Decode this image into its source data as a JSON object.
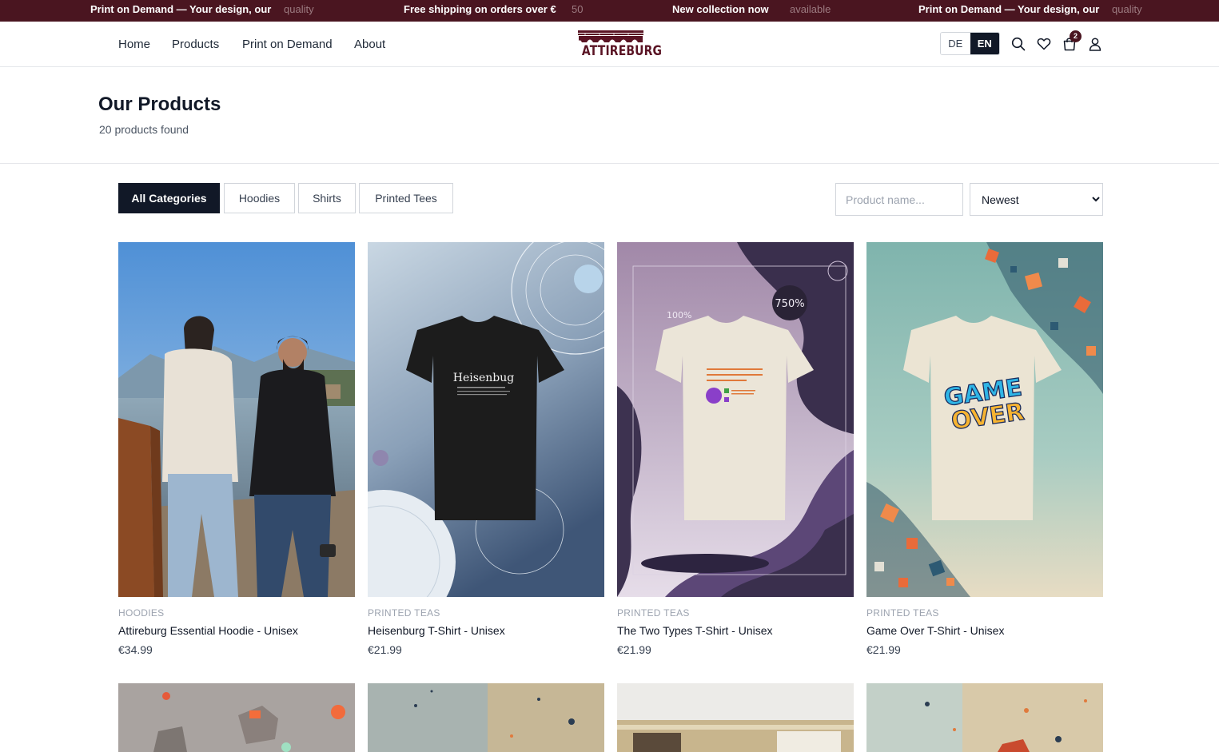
{
  "announcement": {
    "items": [
      {
        "strong": "Print on Demand — Your design, our",
        "dim": "quality"
      },
      {
        "strong": "Free shipping on orders over €",
        "dim": "50"
      },
      {
        "strong": "New collection now",
        "dim": "available"
      },
      {
        "strong": "Print on Demand — Your design, our",
        "dim": "quality"
      }
    ]
  },
  "nav": {
    "items": [
      {
        "label": "Home"
      },
      {
        "label": "Products"
      },
      {
        "label": "Print on Demand"
      },
      {
        "label": "About"
      }
    ]
  },
  "brand": {
    "name": "ATTIREBURG",
    "color": "#5a1424"
  },
  "language": {
    "options": [
      "DE",
      "EN"
    ],
    "active": "EN"
  },
  "header_icons": [
    "search-icon",
    "heart-icon",
    "shopping-bag-icon",
    "user-icon"
  ],
  "cart": {
    "count": "2"
  },
  "page": {
    "title": "Our Products",
    "count_text": "20 products found"
  },
  "filters": {
    "categories": [
      {
        "label": "All Categories",
        "active": true
      },
      {
        "label": "Hoodies",
        "active": false
      },
      {
        "label": "Shirts",
        "active": false
      },
      {
        "label": "Printed Tees",
        "active": false
      }
    ],
    "search_placeholder": "Product name...",
    "sort_options": [
      "Newest"
    ],
    "sort_selected": "Newest"
  },
  "products": [
    {
      "category": "HOODIES",
      "name": "Attireburg Essential Hoodie - Unisex",
      "price": "€34.99"
    },
    {
      "category": "PRINTED TEAS",
      "name": "Heisenburg T-Shirt - Unisex",
      "price": "€21.99",
      "print_text": "Heisenbug"
    },
    {
      "category": "PRINTED TEAS",
      "name": "The Two Types T-Shirt - Unisex",
      "price": "€21.99",
      "print_text": "THERE ARE TWO TYPES OF PEOPLE IN THE UNIVERSE",
      "bg_text": [
        "750%",
        "100%"
      ]
    },
    {
      "category": "PRINTED TEAS",
      "name": "Game Over T-Shirt - Unisex",
      "price": "€21.99",
      "print_text": [
        "GAME",
        "OVER"
      ]
    }
  ],
  "colors": {
    "accent": "#4a1520",
    "dark": "#111827"
  }
}
